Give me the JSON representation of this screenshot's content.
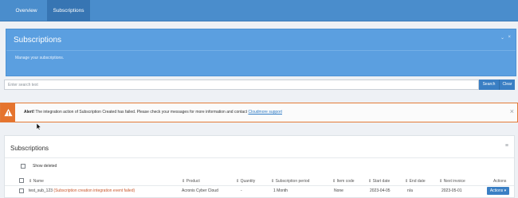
{
  "nav": {
    "tabs": [
      {
        "label": "Overview"
      },
      {
        "label": "Subscriptions"
      }
    ]
  },
  "header": {
    "title": "Subscriptions",
    "subtitle": "Manage your subscriptions."
  },
  "search": {
    "placeholder": "Enter search text",
    "search_label": "Search",
    "clear_label": "Clear"
  },
  "alert": {
    "label": "Alert!",
    "message": "The integration action of Subscription Created has failed. Please check your messages for more information and contact",
    "link": "Cloudmore support"
  },
  "subscriptions": {
    "title": "Subscriptions",
    "show_deleted_label": "Show deleted",
    "columns": [
      "Name",
      "Product",
      "Quantity",
      "Subscription period",
      "Item code",
      "Start date",
      "End date",
      "Next invoice",
      "Actions"
    ],
    "rows": [
      {
        "name": "test_sub_123",
        "status": "(Subscription creation integration event failed)",
        "product": "Acronis Cyber Cloud",
        "quantity": "-",
        "period": "1 Month",
        "item_code": "None",
        "start_date": "2023-04-05",
        "end_date": "n/a",
        "next_invoice": "2023-05-01",
        "action_label": "Actions"
      }
    ]
  },
  "colors": {
    "nav": "#4a8dcc",
    "panel": "#5b9fe0",
    "button": "#3a7fc4",
    "alert": "#e5742e",
    "error_text": "#c9572b"
  }
}
